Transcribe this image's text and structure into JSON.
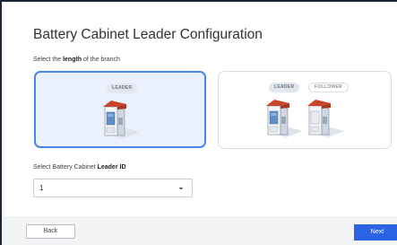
{
  "page": {
    "title": "Battery Cabinet Leader Configuration"
  },
  "branch": {
    "instruction_prefix": "Select the ",
    "instruction_bold": "length",
    "instruction_suffix": " of the branch",
    "options": [
      {
        "badges": [
          "LEADER"
        ],
        "selected": true
      },
      {
        "badges": [
          "LEADER",
          "FOLLOWER"
        ],
        "selected": false
      }
    ]
  },
  "leader_id": {
    "label_prefix": "Select Battery Cabinet ",
    "label_bold": "Leader ID",
    "value": "1"
  },
  "footer": {
    "back_label": "Back",
    "next_label": "Next"
  },
  "colors": {
    "accent": "#2a63e4",
    "selected_border": "#4a86e8",
    "selected_bg": "#eaf1fc",
    "cabinet_roof": "#c9442b"
  },
  "icons": [
    "battery-cabinet-icon",
    "chevron-down-icon"
  ]
}
